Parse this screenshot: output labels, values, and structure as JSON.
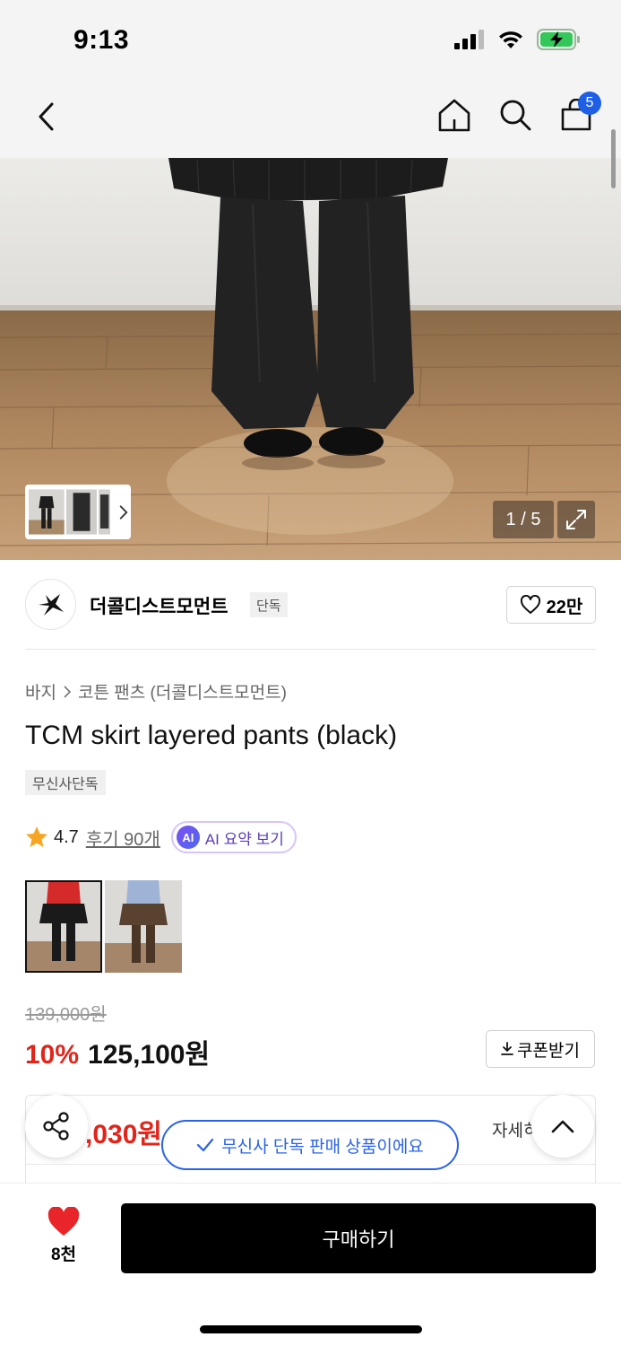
{
  "status_bar": {
    "time": "9:13"
  },
  "nav": {
    "cart_count": "5"
  },
  "gallery": {
    "counter": "1 / 5"
  },
  "brand": {
    "name": "더콜디스트모먼트",
    "tag": "단독",
    "likes": "22만"
  },
  "product": {
    "breadcrumb": [
      "바지",
      "코튼 팬츠 (더콜디스트모먼트)"
    ],
    "title": "TCM skirt layered pants (black)",
    "exclusive_tag": "무신사단독",
    "rating": "4.7",
    "reviews": "후기 90개",
    "ai_badge": "AI",
    "ai_summary": "AI 요약 보기"
  },
  "price": {
    "original": "139,000원",
    "discount": "10%",
    "sale": "125,100원",
    "coupon_label": "쿠폰받기"
  },
  "benefit": {
    "amount": ",030원",
    "detail": "자세히"
  },
  "toast": {
    "message": "무신사 단독 판매 상품이에요"
  },
  "bottom": {
    "wish_count": "8천",
    "buy_label": "구매하기"
  },
  "colors": {
    "accent_blue": "#2a62e8",
    "sale_red": "#e1251b",
    "badge_blue": "#1e5fe6"
  }
}
